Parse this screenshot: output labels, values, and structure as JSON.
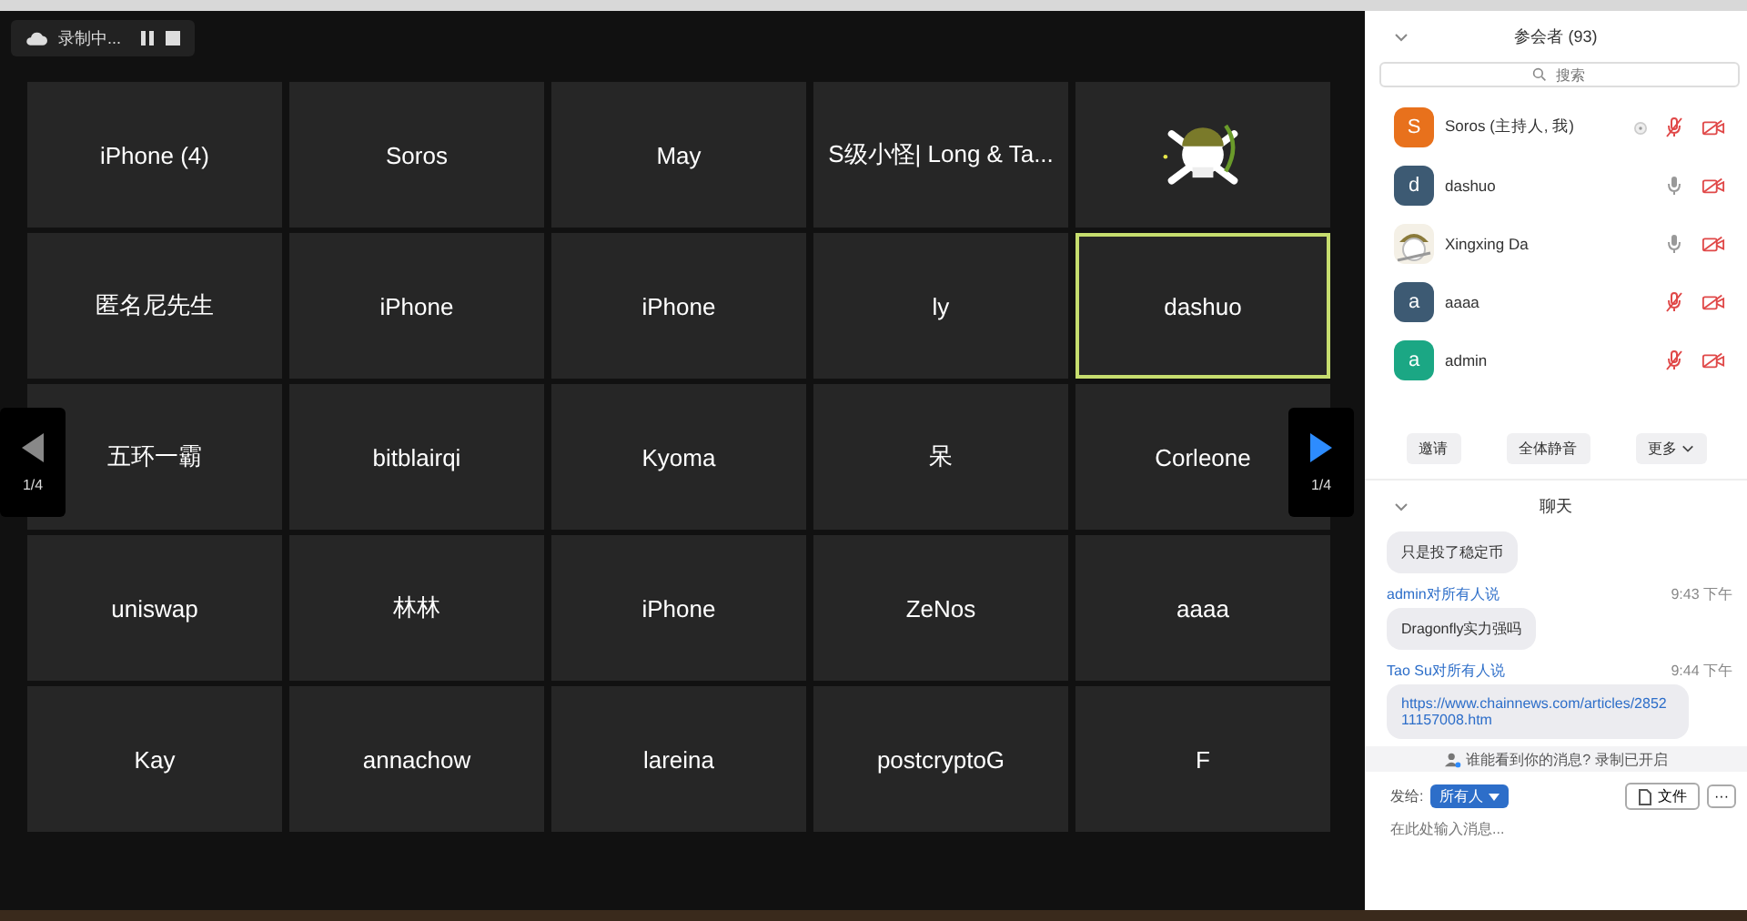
{
  "recording": {
    "label": "录制中..."
  },
  "tiles": [
    {
      "name": "iPhone (4)",
      "speaking": false
    },
    {
      "name": "Soros",
      "speaking": false
    },
    {
      "name": "May",
      "speaking": false
    },
    {
      "name": "S级小怪| Long & Ta...",
      "speaking": false
    },
    {
      "kind": "picture",
      "speaking": false
    },
    {
      "name": "匿名尼先生",
      "speaking": false
    },
    {
      "name": "iPhone",
      "speaking": false
    },
    {
      "name": "iPhone",
      "speaking": false
    },
    {
      "name": "ly",
      "speaking": false
    },
    {
      "name": "dashuo",
      "speaking": true
    },
    {
      "name": "五环一霸",
      "speaking": false
    },
    {
      "name": "bitblairqi",
      "speaking": false
    },
    {
      "name": "Kyoma",
      "speaking": false
    },
    {
      "name": "呆",
      "speaking": false
    },
    {
      "name": "Corleone",
      "speaking": false
    },
    {
      "name": "uniswap",
      "speaking": false
    },
    {
      "name": "林林",
      "speaking": false
    },
    {
      "name": "iPhone",
      "speaking": false
    },
    {
      "name": "ZeNos",
      "speaking": false
    },
    {
      "name": "aaaa",
      "speaking": false
    },
    {
      "name": "Kay",
      "speaking": false
    },
    {
      "name": "annachow",
      "speaking": false
    },
    {
      "name": "lareina",
      "speaking": false
    },
    {
      "name": "postcryptoG",
      "speaking": false
    },
    {
      "name": "F",
      "speaking": false
    }
  ],
  "pager": {
    "prev": {
      "label": "1/4",
      "disabled": true
    },
    "next": {
      "label": "1/4",
      "disabled": false
    }
  },
  "participants": {
    "title": "参会者 (93)",
    "search_placeholder": "搜索",
    "items": [
      {
        "name": "Soros (主持人, 我)",
        "initial": "S",
        "color": "#e8711c",
        "mic_muted": true,
        "host": true
      },
      {
        "name": "dashuo",
        "initial": "d",
        "color": "#3d5a73",
        "mic_muted": false,
        "host": false
      },
      {
        "name": "Xingxing Da",
        "kind": "picture",
        "mic_muted": false,
        "host": false
      },
      {
        "name": "aaaa",
        "initial": "a",
        "color": "#3d5a73",
        "mic_muted": true,
        "host": false
      },
      {
        "name": "admin",
        "initial": "a",
        "color": "#1ba784",
        "mic_muted": true,
        "host": false
      }
    ],
    "buttons": [
      "邀请",
      "全体静音",
      "更多"
    ]
  },
  "chat": {
    "title": "聊天",
    "messages": [
      {
        "text": "只是投了稳定币",
        "kind": "text"
      },
      {
        "sender": "admin对所有人说",
        "time": "9:43 下午",
        "text": "Dragonfly实力强吗",
        "kind": "text"
      },
      {
        "sender": "Tao Su对所有人说",
        "time": "9:44 下午",
        "text": "https://www.chainnews.com/articles/285211157008.htm",
        "kind": "link"
      }
    ],
    "notice": "谁能看到你的消息? 录制已开启",
    "to_label": "发给:",
    "to_value": "所有人",
    "file_button": "文件",
    "more_button": "···",
    "placeholder": "在此处输入消息..."
  }
}
